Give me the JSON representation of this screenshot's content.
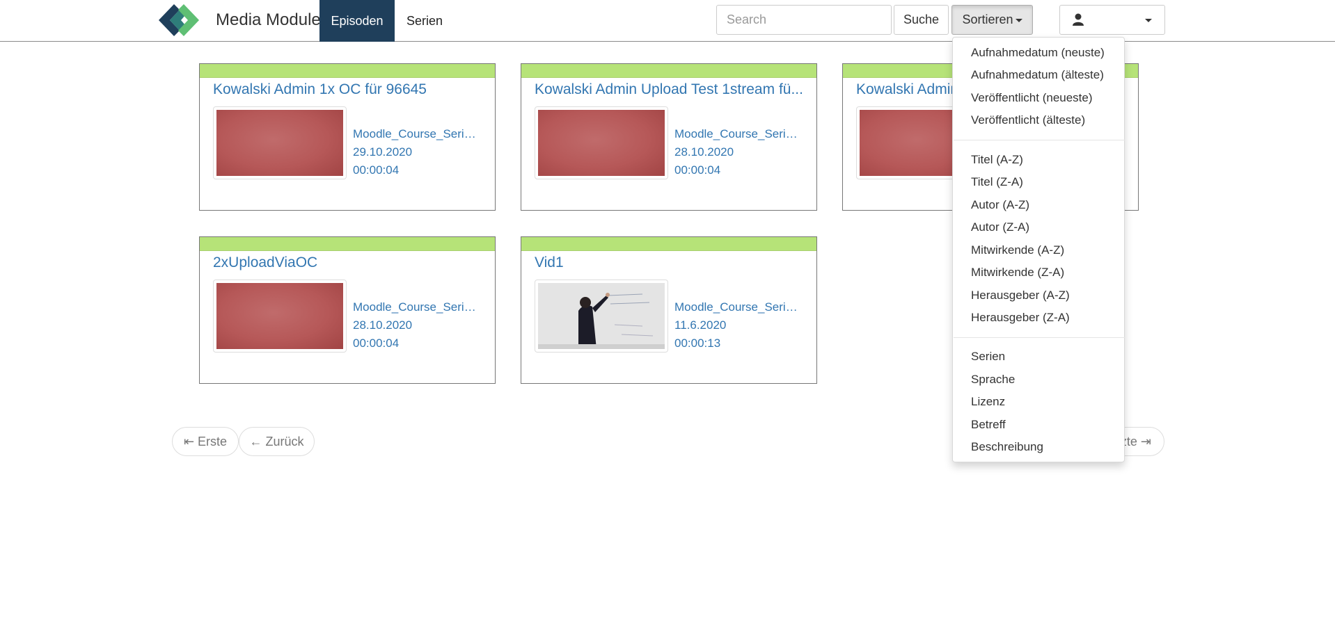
{
  "header": {
    "brand": "Media Module",
    "tabs": [
      "Episoden",
      "Serien"
    ],
    "search": {
      "placeholder": "Search",
      "value": ""
    },
    "search_button": "Suche",
    "sort_button": "Sortieren",
    "colors": {
      "nav_active": "#1f3f5b",
      "link": "#3276b1",
      "card_bar": "#b6e378"
    }
  },
  "episodes": [
    {
      "title": "Kowalski Admin 1x OC für 96645",
      "series": "Moodle_Course_Serie...",
      "date": "29.10.2020",
      "duration": "00:00:04"
    },
    {
      "title": "Kowalski Admin Upload Test 1stream fü...",
      "series": "Moodle_Course_Serie...",
      "date": "28.10.2020",
      "duration": "00:00:04"
    },
    {
      "title": "Kowalski Admin",
      "series": "",
      "date": "",
      "duration": ""
    },
    {
      "title": "2xUploadViaOC",
      "series": "Moodle_Course_Serie...",
      "date": "28.10.2020",
      "duration": "00:00:04"
    },
    {
      "title": "Vid1",
      "series": "Moodle_Course_Serie...",
      "date": "11.6.2020",
      "duration": "00:00:13"
    }
  ],
  "pagination": {
    "first": "⇤ Erste",
    "prev": "← Zurück",
    "last": "zte ⇥"
  },
  "sort_menu": {
    "group1": [
      "Aufnahmedatum (neuste)",
      "Aufnahmedatum (älteste)",
      "Veröffentlicht (neueste)",
      "Veröffentlicht (älteste)"
    ],
    "group2": [
      "Titel (A-Z)",
      "Titel (Z-A)",
      "Autor (A-Z)",
      "Autor (Z-A)",
      "Mitwirkende (A-Z)",
      "Mitwirkende (Z-A)",
      "Herausgeber (A-Z)",
      "Herausgeber (Z-A)"
    ],
    "group3": [
      "Serien",
      "Sprache",
      "Lizenz",
      "Betreff",
      "Beschreibung"
    ]
  }
}
